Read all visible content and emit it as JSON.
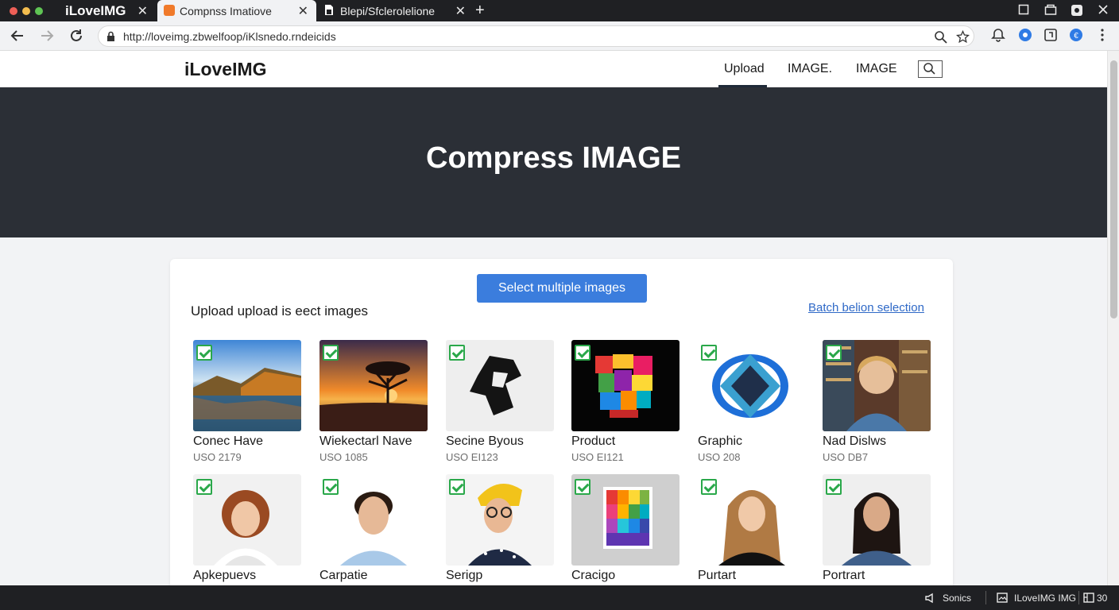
{
  "browser": {
    "tabs": [
      {
        "label": "iLoveIMG",
        "active": false
      },
      {
        "label": "Compnss Imatiove",
        "active": true
      },
      {
        "label": "Blepi/Sfclerolelione",
        "active": false
      }
    ],
    "url": "http://loveimg.zbwelfoop/iKlsnedo.rndeicids"
  },
  "site": {
    "logo": "iLoveIMG",
    "nav": [
      "Upload",
      "IMAGE.",
      "IMAGE"
    ]
  },
  "hero": {
    "title": "Compress IMAGE"
  },
  "upload": {
    "select_button": "Select multiple images",
    "label": "Upload upload is eect images",
    "batch_link": "Batch belion selection"
  },
  "images": [
    {
      "name": "Conec Have",
      "size": "USO 2179",
      "thumb": "lake-landscape",
      "checked": true
    },
    {
      "name": "Wiekectarl Nave",
      "size": "USO 1085",
      "thumb": "sunset-tree",
      "checked": true
    },
    {
      "name": "Secine Byous",
      "size": "USO EI123",
      "thumb": "black-sculpture",
      "checked": true
    },
    {
      "name": "Product",
      "size": "USO EI121",
      "thumb": "color-mosaic",
      "checked": true
    },
    {
      "name": "Graphic",
      "size": "USO 208",
      "thumb": "blue-polygon",
      "checked": true
    },
    {
      "name": "Nad Dislws",
      "size": "USO DB7",
      "thumb": "woman-bookshelf",
      "checked": true
    },
    {
      "name": "Apkepuevs",
      "size": "",
      "thumb": "woman-curly-hair",
      "checked": true
    },
    {
      "name": "Carpatie",
      "size": "",
      "thumb": "man-portrait",
      "checked": true
    },
    {
      "name": "Serigp",
      "size": "",
      "thumb": "woman-glasses",
      "checked": true
    },
    {
      "name": "Cracigo",
      "size": "",
      "thumb": "rainbow-grid",
      "checked": true
    },
    {
      "name": "Purtart",
      "size": "",
      "thumb": "woman-long-hair",
      "checked": true
    },
    {
      "name": "Portrart",
      "size": "",
      "thumb": "woman-dark-hair",
      "checked": true
    }
  ],
  "statusbar": {
    "item1": "Sonics",
    "item2": "ILoveIMG IMG",
    "item3": "30"
  },
  "colors": {
    "accent": "#3b7ddd",
    "hero_bg": "#2b2f36",
    "check": "#2aa84a",
    "link": "#2f69c7"
  }
}
